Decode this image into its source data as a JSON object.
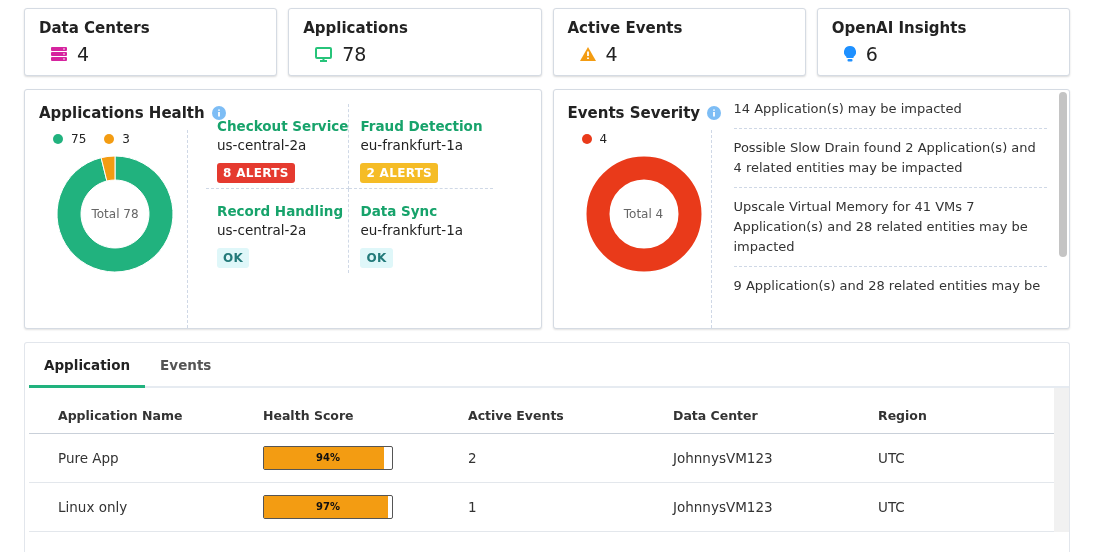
{
  "summary_cards": [
    {
      "kind": "datacenter",
      "title": "Data Centers",
      "value": "4"
    },
    {
      "kind": "application",
      "title": "Applications",
      "value": "78"
    },
    {
      "kind": "warning",
      "title": "Active Events",
      "value": "4"
    },
    {
      "kind": "insight",
      "title": "OpenAI Insights",
      "value": "6"
    }
  ],
  "applications_health": {
    "title": "Applications Health",
    "legend": [
      {
        "value": "75",
        "color": "#21b27e"
      },
      {
        "value": "3",
        "color": "#f39c12"
      }
    ],
    "center_label": "Total 78",
    "apps": [
      {
        "name": "Checkout Service",
        "region": "us-central-2a",
        "kind": "critical",
        "badge": "8 ALERTS"
      },
      {
        "name": "Fraud Detection",
        "region": "eu-frankfurt-1a",
        "kind": "warning",
        "badge": "2 ALERTS"
      },
      {
        "name": "Record Handling",
        "region": "us-central-2a",
        "kind": "ok",
        "badge": "OK"
      },
      {
        "name": "Data Sync",
        "region": "eu-frankfurt-1a",
        "kind": "ok",
        "badge": "OK"
      }
    ]
  },
  "events_severity": {
    "title": "Events Severity",
    "legend": [
      {
        "value": "4",
        "color": "#e93a1a"
      }
    ],
    "center_label": "Total 4",
    "events": [
      "14 Application(s) may be impacted",
      "Possible Slow Drain found 2 Application(s) and 4 related entities may be impacted",
      "Upscale Virtual Memory for 41 VMs 7 Application(s) and 28 related entities may be impacted",
      "9 Application(s) and 28 related entities may be"
    ]
  },
  "tabs": [
    {
      "label": "Application",
      "selected": true
    },
    {
      "label": "Events",
      "selected": false
    }
  ],
  "table": {
    "columns": [
      "Application Name",
      "Health Score",
      "Active Events",
      "Data Center",
      "Region"
    ],
    "rows": [
      {
        "name": "Pure App",
        "health": {
          "level": 0.94,
          "label": "94%"
        },
        "active_events": "2",
        "data_center": "JohnnysVM123",
        "region": "UTC"
      },
      {
        "name": "Linux only",
        "health": {
          "level": 0.97,
          "label": "97%"
        },
        "active_events": "1",
        "data_center": "JohnnysVM123",
        "region": "UTC"
      }
    ]
  }
}
